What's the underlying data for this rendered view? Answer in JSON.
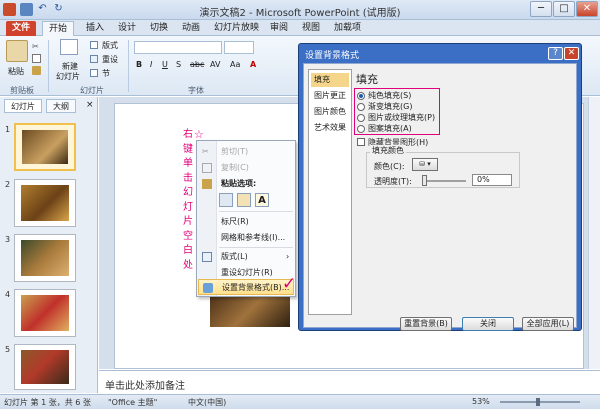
{
  "window": {
    "title": "演示文稿2 - Microsoft PowerPoint (试用版)",
    "minimize": "─",
    "maximize": "□",
    "close": "✕"
  },
  "ribbon_tabs": [
    "文件",
    "开始",
    "插入",
    "设计",
    "切换",
    "动画",
    "幻灯片放映",
    "审阅",
    "视图",
    "加载项"
  ],
  "ribbon": {
    "paste": "粘贴",
    "new_slide_line1": "新建",
    "new_slide_line2": "幻灯片",
    "layout": "版式",
    "reset": "重设",
    "section": "节",
    "font_buttons": [
      "B",
      "I",
      "U",
      "S",
      "abc",
      "AV",
      "Aa",
      "A"
    ],
    "groups": [
      "剪贴板",
      "幻灯片",
      "字体"
    ]
  },
  "left_pane": {
    "tabs": [
      "幻灯片",
      "大纲"
    ],
    "close": "×",
    "slide_numbers": [
      "1",
      "2",
      "3",
      "4",
      "5"
    ]
  },
  "slide": {
    "vertical_text": [
      "右",
      "键",
      "单",
      "击",
      "幻",
      "灯",
      "片",
      "空",
      "白",
      "处"
    ],
    "star": "☆"
  },
  "context_menu": {
    "items": [
      "剪切(T)",
      "复制(C)",
      "粘贴选项:",
      "标尺(R)",
      "网格和参考线(I)...",
      "版式(L)",
      "重设幻灯片(R)",
      "设置背景格式(B)..."
    ],
    "paste_icon_letter": "A",
    "checkmark": "✓"
  },
  "notes": {
    "placeholder": "单击此处添加备注"
  },
  "status_bar": {
    "slide_info": "幻灯片 第 1 张，共 6 张",
    "theme": "\"Office 主题\"",
    "language": "中文(中国)",
    "zoom": "53%"
  },
  "dialog": {
    "title": "设置背景格式",
    "help": "?",
    "close": "✕",
    "categories": [
      "填充",
      "图片更正",
      "图片颜色",
      "艺术效果"
    ],
    "section_title": "填充",
    "fill_options": [
      "纯色填充(S)",
      "渐变填充(G)",
      "图片或纹理填充(P)",
      "图案填充(A)"
    ],
    "selected_fill": "纯色填充(S)",
    "hide_background": "隐藏背景图形(H)",
    "fill_color_title": "填充颜色",
    "color_label": "颜色(C):",
    "transparency_label": "透明度(T):",
    "transparency_value": "0%",
    "buttons": {
      "reset": "重置背景(B)",
      "close": "关闭",
      "apply_all": "全部应用(L)"
    }
  },
  "colors": {
    "accent_red": "#e0007a",
    "dialog_blue": "#3b6fc5",
    "file_tab": "#d0422c",
    "highlight_yellow": "#f5d58a"
  }
}
